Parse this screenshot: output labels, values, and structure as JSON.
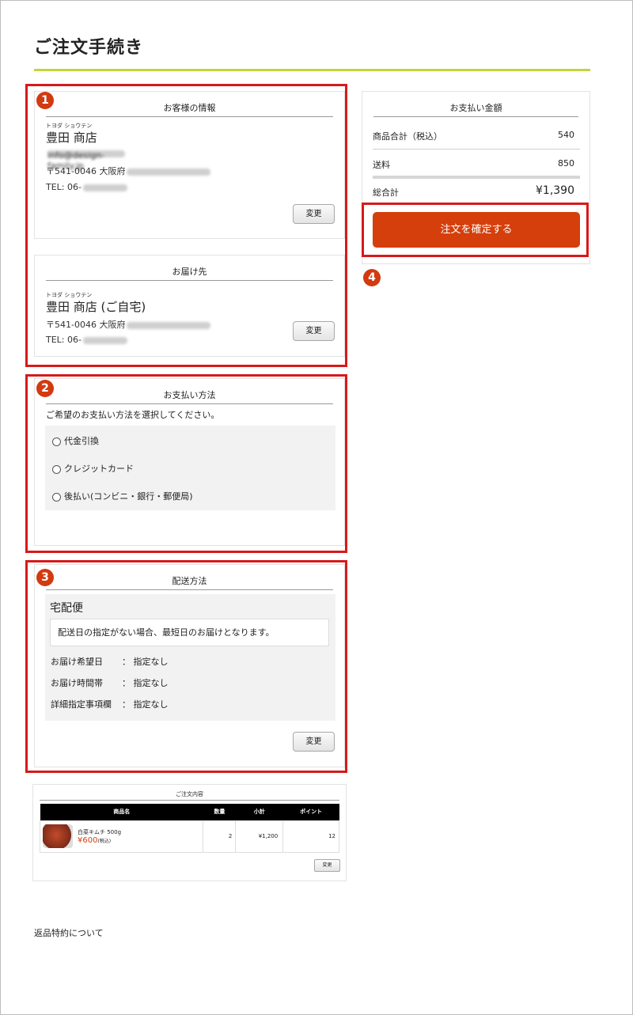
{
  "page": {
    "title": "ご注文手続き"
  },
  "markers": [
    "1",
    "2",
    "3",
    "4"
  ],
  "customer": {
    "heading": "お客様の情報",
    "furigana": "トヨダ ショウテン",
    "name": "豊田 商店",
    "email": "info@design-family.jp",
    "address": "〒541-0046 大阪府",
    "tel": "TEL: 06-",
    "change_label": "変更"
  },
  "delivery": {
    "heading": "お届け先",
    "furigana": "トヨダ ショウテン",
    "name": "豊田 商店 (ご自宅)",
    "address": "〒541-0046 大阪府",
    "tel": "TEL: 06-",
    "change_label": "変更"
  },
  "payment_method": {
    "heading": "お支払い方法",
    "instruction": "ご希望のお支払い方法を選択してください。",
    "options": [
      "代金引換",
      "クレジットカード",
      "後払い(コンビニ・銀行・郵便局)"
    ]
  },
  "shipping": {
    "heading": "配送方法",
    "method": "宅配便",
    "note": "配送日の指定がない場合、最短日のお届けとなります。",
    "rows": [
      {
        "label": "お届け希望日",
        "value": "：  指定なし"
      },
      {
        "label": "お届け時間帯",
        "value": "：  指定なし"
      },
      {
        "label": "詳細指定事項欄",
        "value": "：  指定なし"
      }
    ],
    "change_label": "変更"
  },
  "order": {
    "heading": "ご注文内容",
    "columns": [
      "商品名",
      "数量",
      "小計",
      "ポイント"
    ],
    "items": [
      {
        "name": "白菜キムチ 500g",
        "price": "¥600",
        "tax": "(税込)",
        "qty": "2",
        "subtotal": "¥1,200",
        "points": "12"
      }
    ],
    "change_label": "変更"
  },
  "summary": {
    "heading": "お支払い金額",
    "rows": [
      {
        "label": "商品合計（税込）",
        "value": "540"
      },
      {
        "label": "送料",
        "value": "850"
      }
    ],
    "total_label": "総合計",
    "total_value": "¥1,390",
    "confirm_label": "注文を確定する"
  },
  "footer": {
    "returns_link": "返品特約について"
  },
  "colors": {
    "accent_rule": "#c7d23a",
    "confirm_button": "#d53f0b",
    "marker": "#d23a10",
    "highlight_box": "#d61a1a"
  }
}
